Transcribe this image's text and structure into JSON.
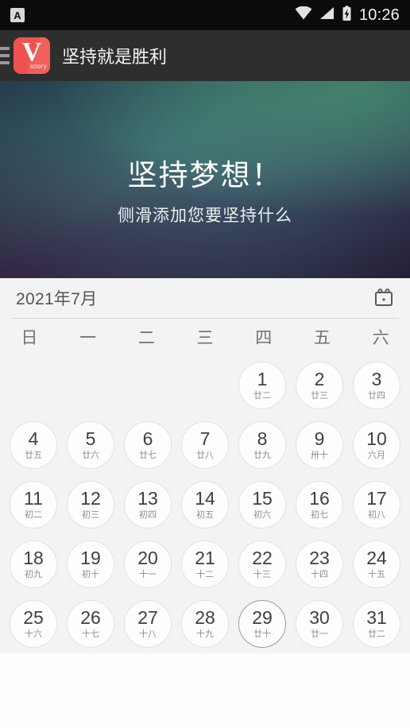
{
  "statusbar": {
    "ime_icon_label": "A",
    "time": "10:26",
    "icons": [
      "wifi-icon",
      "signal-icon",
      "battery-charging-icon"
    ]
  },
  "appbar": {
    "title": "坚持就是胜利",
    "logo_letter": "V",
    "logo_word": "ictory",
    "logo_color": "#ef5350",
    "menu_icon": "hamburger-menu-icon"
  },
  "hero": {
    "title": "坚持梦想！",
    "subtitle": "侧滑添加您要坚持什么",
    "gradient_top_right": "#4f9a81",
    "gradient_bottom_left": "#2e2545"
  },
  "calendar": {
    "month_label": "2021年7月",
    "picker_icon": "calendar-icon",
    "weekdays": [
      "日",
      "一",
      "二",
      "三",
      "四",
      "五",
      "六"
    ],
    "today": 29,
    "weeks": [
      [
        {
          "day": "",
          "lunar": ""
        },
        {
          "day": "",
          "lunar": ""
        },
        {
          "day": "",
          "lunar": ""
        },
        {
          "day": "",
          "lunar": ""
        },
        {
          "day": "1",
          "lunar": "廿二"
        },
        {
          "day": "2",
          "lunar": "廿三"
        },
        {
          "day": "3",
          "lunar": "廿四"
        }
      ],
      [
        {
          "day": "4",
          "lunar": "廿五"
        },
        {
          "day": "5",
          "lunar": "廿六"
        },
        {
          "day": "6",
          "lunar": "廿七"
        },
        {
          "day": "7",
          "lunar": "廿八"
        },
        {
          "day": "8",
          "lunar": "廿九"
        },
        {
          "day": "9",
          "lunar": "卅十"
        },
        {
          "day": "10",
          "lunar": "六月"
        }
      ],
      [
        {
          "day": "11",
          "lunar": "初二"
        },
        {
          "day": "12",
          "lunar": "初三"
        },
        {
          "day": "13",
          "lunar": "初四"
        },
        {
          "day": "14",
          "lunar": "初五"
        },
        {
          "day": "15",
          "lunar": "初六"
        },
        {
          "day": "16",
          "lunar": "初七"
        },
        {
          "day": "17",
          "lunar": "初八"
        }
      ],
      [
        {
          "day": "18",
          "lunar": "初九"
        },
        {
          "day": "19",
          "lunar": "初十"
        },
        {
          "day": "20",
          "lunar": "十一"
        },
        {
          "day": "21",
          "lunar": "十二"
        },
        {
          "day": "22",
          "lunar": "十三"
        },
        {
          "day": "23",
          "lunar": "十四"
        },
        {
          "day": "24",
          "lunar": "十五"
        }
      ],
      [
        {
          "day": "25",
          "lunar": "十六"
        },
        {
          "day": "26",
          "lunar": "十七"
        },
        {
          "day": "27",
          "lunar": "十八"
        },
        {
          "day": "28",
          "lunar": "十九"
        },
        {
          "day": "29",
          "lunar": "廿十"
        },
        {
          "day": "30",
          "lunar": "廿一"
        },
        {
          "day": "31",
          "lunar": "廿二"
        }
      ]
    ]
  }
}
